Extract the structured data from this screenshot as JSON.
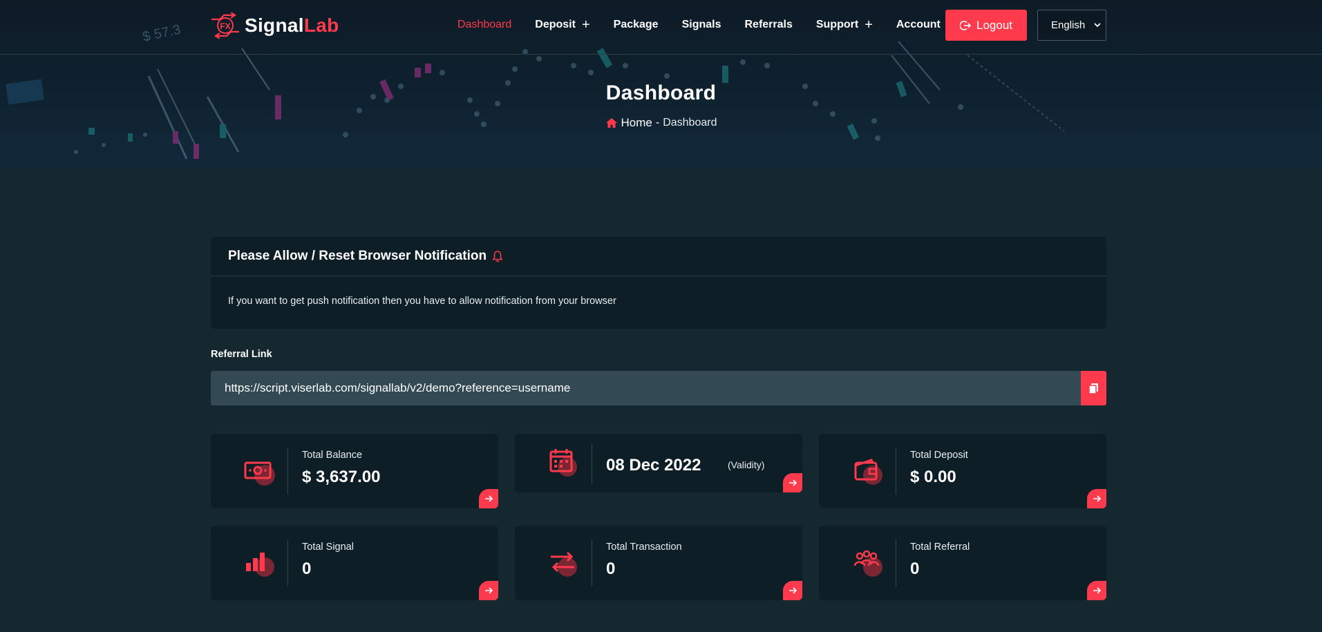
{
  "brand": {
    "logo_badge": "FX",
    "name_part1": "Signal",
    "name_part2": "Lab",
    "accent_color": "#ff3a4c"
  },
  "nav": {
    "items": [
      {
        "label": "Dashboard",
        "active": true,
        "has_submenu": false
      },
      {
        "label": "Deposit",
        "active": false,
        "has_submenu": true,
        "plus": "+"
      },
      {
        "label": "Package",
        "active": false,
        "has_submenu": false
      },
      {
        "label": "Signals",
        "active": false,
        "has_submenu": false
      },
      {
        "label": "Referrals",
        "active": false,
        "has_submenu": false
      },
      {
        "label": "Support",
        "active": false,
        "has_submenu": true,
        "plus": "+"
      },
      {
        "label": "Account",
        "active": false,
        "has_submenu": true,
        "plus": "+"
      }
    ],
    "logout_label": "Logout",
    "logout_icon": "logout-icon",
    "language_selected": "English"
  },
  "hero": {
    "title": "Dashboard",
    "breadcrumb_home": "Home",
    "breadcrumb_separator": "-",
    "breadcrumb_current": "Dashboard",
    "home_icon": "home-icon"
  },
  "notification": {
    "title": "Please Allow / Reset Browser Notification",
    "icon": "bell-icon",
    "body": "If you want to get push notification then you have to allow notification from your browser"
  },
  "referral": {
    "label": "Referral Link",
    "url": "https://script.viserlab.com/signallab/v2/demo?reference=username",
    "copy_icon": "copy-icon"
  },
  "stats": {
    "total_balance": {
      "label": "Total Balance",
      "value": "$ 3,637.00",
      "icon": "cash-icon"
    },
    "validity": {
      "date": "08 Dec 2022",
      "note": "(Validity)",
      "icon": "calendar-icon"
    },
    "total_deposit": {
      "label": "Total Deposit",
      "value": "$ 0.00",
      "icon": "wallet-icon"
    },
    "total_signal": {
      "label": "Total Signal",
      "value": "0",
      "icon": "bar-chart-icon"
    },
    "total_transaction": {
      "label": "Total Transaction",
      "value": "0",
      "icon": "exchange-icon"
    },
    "total_referral": {
      "label": "Total Referral",
      "value": "0",
      "icon": "users-icon"
    }
  }
}
